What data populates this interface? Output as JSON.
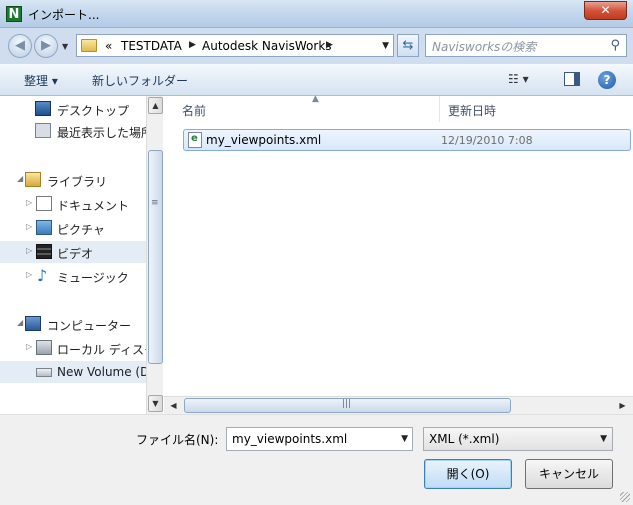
{
  "window": {
    "title": "インポート...",
    "app_icon_letter": "N",
    "close_symbol": "✕"
  },
  "address": {
    "prefix": "«",
    "crumbs": [
      "TESTDATA",
      "Autodesk NavisWorks"
    ],
    "separator": "▶"
  },
  "search": {
    "placeholder": "Navisworksの検索"
  },
  "toolbar": {
    "organize_label": "整理 ▾",
    "new_folder_label": "新しいフォルダー"
  },
  "nav_items": [
    {
      "label": "デスクトップ",
      "icon": "desktop-icon"
    },
    {
      "label": "最近表示した場所",
      "icon": "recent-places-icon"
    },
    {
      "label": "ライブラリ",
      "icon": "library-icon"
    },
    {
      "label": "ドキュメント",
      "icon": "documents-icon"
    },
    {
      "label": "ピクチャ",
      "icon": "pictures-icon"
    },
    {
      "label": "ビデオ",
      "icon": "videos-icon"
    },
    {
      "label": "ミュージック",
      "icon": "music-icon"
    },
    {
      "label": "コンピューター",
      "icon": "computer-icon"
    },
    {
      "label": "ローカル ディスク",
      "icon": "local-disk-icon"
    },
    {
      "label": "New Volume (D",
      "icon": "volume-icon"
    }
  ],
  "columns": {
    "name": "名前",
    "date_modified": "更新日時"
  },
  "files": [
    {
      "name": "my_viewpoints.xml",
      "date": "12/19/2010 7:08",
      "icon": "xml-file-icon"
    }
  ],
  "bottom": {
    "filename_label": "ファイル名(N):",
    "filename_value": "my_viewpoints.xml",
    "filter_value": "XML (*.xml)",
    "open_label": "開く(O)",
    "cancel_label": "キャンセル"
  },
  "colors": {
    "accent": "#3c7fb1",
    "selection": "#d9e8fb",
    "close_button": "#c23a1f"
  }
}
